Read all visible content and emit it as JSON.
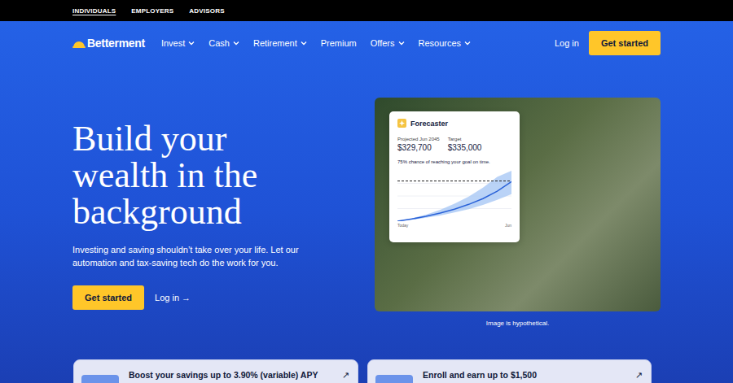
{
  "audience_tabs": [
    {
      "label": "INDIVIDUALS",
      "selected": true
    },
    {
      "label": "EMPLOYERS",
      "selected": false
    },
    {
      "label": "ADVISORS",
      "selected": false
    }
  ],
  "nav": {
    "brand": "Betterment",
    "links": [
      {
        "label": "Invest",
        "dropdown": true
      },
      {
        "label": "Cash",
        "dropdown": true
      },
      {
        "label": "Retirement",
        "dropdown": true
      },
      {
        "label": "Premium",
        "dropdown": false
      },
      {
        "label": "Offers",
        "dropdown": true
      },
      {
        "label": "Resources",
        "dropdown": true
      }
    ],
    "login": "Log in",
    "cta": "Get started"
  },
  "hero": {
    "title": "Build your wealth in the background",
    "body": "Investing and saving shouldn’t take over your life. Let our automation and tax-saving tech do the work for you.",
    "cta": "Get started",
    "login": "Log in",
    "login_arrow": "→"
  },
  "forecaster": {
    "title": "Forecaster",
    "projected_label": "Projected Jun 2045",
    "projected_value": "$329,700",
    "target_label": "Target",
    "target_value": "$335,000",
    "chance": "75% chance of reaching your goal on time.",
    "axis_start": "Today",
    "axis_end": "Jun",
    "chart": {
      "max": 420,
      "target": 335,
      "median": [
        0,
        18,
        40,
        68,
        100,
        140,
        188,
        250,
        330
      ],
      "upper": [
        0,
        24,
        55,
        95,
        145,
        205,
        280,
        370,
        470
      ],
      "lower": [
        0,
        12,
        28,
        48,
        72,
        100,
        135,
        178,
        225
      ]
    }
  },
  "image_caption": "Image is hypothetical.",
  "promos": [
    {
      "title": "Boost your savings up to 3.90% (variable) APY",
      "arrow": "↗"
    },
    {
      "title": "Enroll and earn up to $1,500",
      "arrow": "↗"
    }
  ]
}
